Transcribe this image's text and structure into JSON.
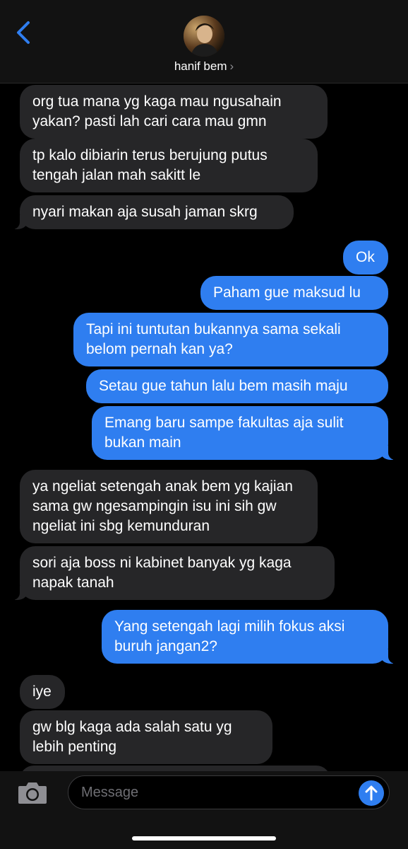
{
  "header": {
    "contact_name": "hanif bem",
    "chevron": "›",
    "back_icon": "chevron-left-icon",
    "accent": "#2f7ef0"
  },
  "messages": [
    {
      "from": "them",
      "text": "org tua mana yg kaga mau ngusahain yakan? pasti lah cari cara mau gmn"
    },
    {
      "from": "them",
      "text": "tp kalo dibiarin terus berujung putus tengah jalan mah sakitt le"
    },
    {
      "from": "them",
      "text": "nyari makan aja susah jaman skrg"
    },
    {
      "from": "me",
      "text": "Ok"
    },
    {
      "from": "me",
      "text": "Paham gue maksud lu"
    },
    {
      "from": "me",
      "text": "Tapi ini tuntutan bukannya sama sekali belom pernah kan ya?"
    },
    {
      "from": "me",
      "text": "Setau gue tahun lalu bem masih maju"
    },
    {
      "from": "me",
      "text": "Emang baru sampe fakultas aja sulit bukan main"
    },
    {
      "from": "them",
      "text": "ya ngeliat setengah anak bem yg kajian sama gw ngesampingin isu ini sih gw ngeliat ini sbg kemunduran"
    },
    {
      "from": "them",
      "text": "sori aja boss ni kabinet banyak yg kaga napak tanah"
    },
    {
      "from": "me",
      "text": "Yang setengah lagi milih fokus aksi buruh jangan2?"
    },
    {
      "from": "them",
      "text": "iye"
    },
    {
      "from": "them",
      "text": "gw blg kaga ada salah satu yg lebih penting"
    }
  ],
  "composer": {
    "placeholder": "Message",
    "camera_icon": "camera-icon",
    "send_icon": "arrow-up-icon"
  }
}
